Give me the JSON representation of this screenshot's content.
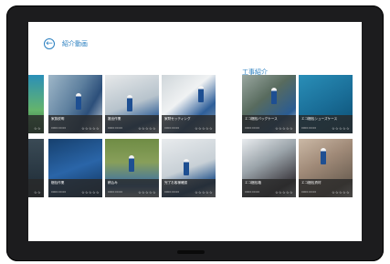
{
  "page": {
    "back_glyph": "←",
    "title": "紹介動画",
    "section_title": "工事紹介"
  },
  "tiles": [
    {
      "label": "",
      "meta": "",
      "stars": "☆☆"
    },
    {
      "label": "家族説明",
      "meta": "0000:00:00",
      "stars": "☆☆☆☆☆"
    },
    {
      "label": "搬出作業",
      "meta": "0000:00:00",
      "stars": "☆☆☆☆☆"
    },
    {
      "label": "家財セッティング",
      "meta": "0000:00:00",
      "stars": "☆☆☆☆☆"
    },
    {
      "label": "",
      "meta": "",
      "stars": "☆☆"
    },
    {
      "label": "梱包作業",
      "meta": "0000:00:00",
      "stars": "☆☆☆☆☆"
    },
    {
      "label": "積込み",
      "meta": "0000:00:00",
      "stars": "☆☆☆☆☆"
    },
    {
      "label": "完了お客様確認",
      "meta": "0000:00:00",
      "stars": "☆☆☆☆☆"
    },
    {
      "label": "エコ梱包バッグケース",
      "meta": "0000:00:00",
      "stars": "☆☆☆☆☆"
    },
    {
      "label": "エコ梱包シューズケース",
      "meta": "0000:00:00",
      "stars": "☆☆☆☆☆"
    },
    {
      "label": "エコ梱包箱",
      "meta": "0000:00:00",
      "stars": "☆☆☆☆☆"
    },
    {
      "label": "エコ梱包資材",
      "meta": "0000:00:00",
      "stars": "☆☆☆☆☆"
    }
  ],
  "colors": {
    "accent": "#2a7fc0",
    "bezel": "#1c1c1e"
  }
}
